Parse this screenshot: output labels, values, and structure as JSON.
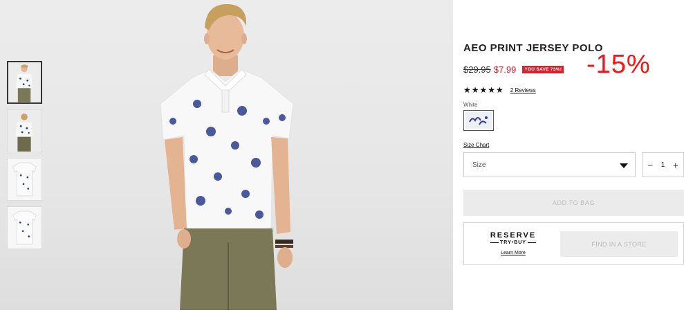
{
  "product": {
    "title": "AEO PRINT JERSEY POLO",
    "old_price": "$29.95",
    "new_price": "$7.99",
    "save_badge": "YOU SAVE 73%!",
    "discount_overlay": "-15%",
    "stars": "★★★★★",
    "rating": 5,
    "reviews_link": "2 Reviews",
    "color_label": "White",
    "size_chart_link": "Size Chart",
    "size_select": "Size",
    "qty_minus": "−",
    "qty_value": "1",
    "qty_plus": "+",
    "add_to_bag": "ADD TO BAG",
    "reserve": {
      "title": "RESERVE",
      "subtitle": "TRY•BUY",
      "learn_more": "Learn More",
      "find_store": "FIND IN A STORE"
    }
  },
  "colors": {
    "sale_red": "#e11d2a",
    "overlay_red": "#ff1111",
    "button_disabled_bg": "#ebebeb",
    "button_disabled_text": "#bdbdbd",
    "print_blue": "#2c3e8c",
    "pants_olive": "#7b7858"
  },
  "gallery": {
    "thumbnails": [
      "front-view",
      "back-view",
      "flat-front",
      "flat-back"
    ],
    "active_index": 0
  }
}
